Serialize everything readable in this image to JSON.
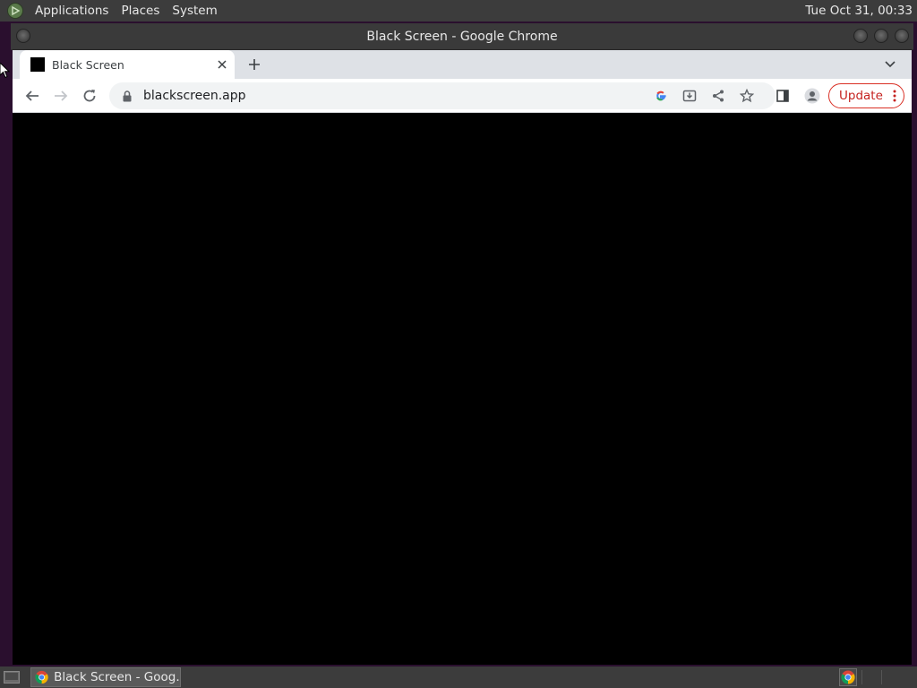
{
  "top_panel": {
    "menus": [
      "Applications",
      "Places",
      "System"
    ],
    "clock": "Tue Oct 31, 00:33"
  },
  "window": {
    "title": "Black Screen - Google Chrome"
  },
  "tab": {
    "title": "Black Screen",
    "favicon_color": "#000000"
  },
  "toolbar": {
    "url": "blackscreen.app",
    "update_label": "Update",
    "update_color": "#d93025"
  },
  "viewport": {
    "background": "#000000"
  },
  "taskbar": {
    "task_label": "Black Screen - Goog..."
  },
  "icons": {
    "back": "arrow-left-icon",
    "forward": "arrow-right-icon",
    "reload": "reload-icon",
    "lock": "lock-icon",
    "google": "google-icon",
    "install": "install-icon",
    "share": "share-icon",
    "bookmark": "star-icon",
    "side_panel": "side-panel-icon",
    "profile": "profile-icon",
    "menu": "kebab-menu-icon"
  }
}
